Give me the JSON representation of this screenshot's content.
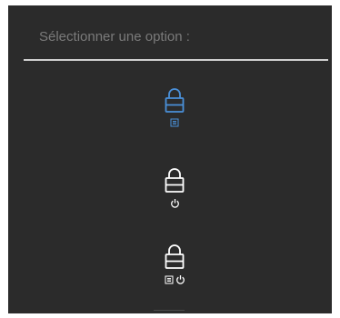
{
  "menu": {
    "title": "Sélectionner une option :",
    "options": [
      {
        "icon": "lock-menu-icon",
        "sub_icons": [
          "menu-icon"
        ],
        "selected": true
      },
      {
        "icon": "lock-power-icon",
        "sub_icons": [
          "power-icon"
        ],
        "selected": false
      },
      {
        "icon": "lock-menu-power-icon",
        "sub_icons": [
          "menu-icon",
          "power-icon"
        ],
        "selected": false
      }
    ]
  },
  "colors": {
    "background": "#2b2b2b",
    "title_text": "#7a7a7a",
    "divider": "#cfcfcf",
    "selected_icon": "#4a90d9",
    "icon": "#ffffff"
  }
}
